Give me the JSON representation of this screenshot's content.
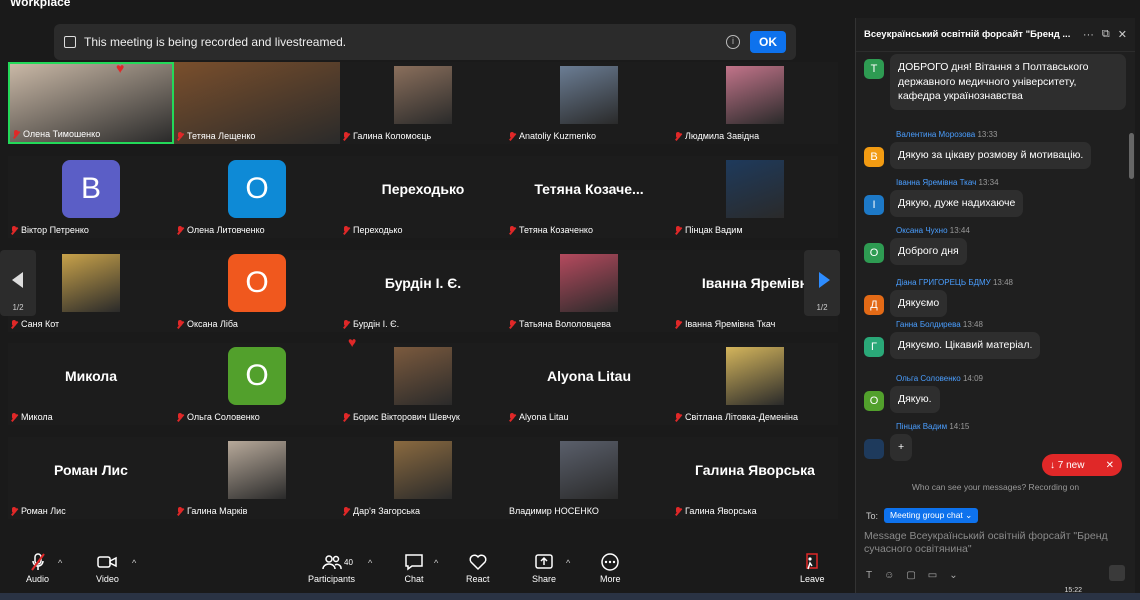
{
  "app": {
    "brand": "Workplace"
  },
  "banner": {
    "text": "This meeting is being recorded and livestreamed.",
    "ok_label": "OK",
    "info_icon": "info-icon"
  },
  "grid": {
    "tiles": [
      {
        "name": "Олена Тимошенко",
        "kind": "photo",
        "active": true,
        "photo_color": "#c9b8a6"
      },
      {
        "name": "Тетяна Лещенко",
        "kind": "photo",
        "photo_color": "#7a4f2c"
      },
      {
        "name": "Галина Коломоєць",
        "kind": "photo",
        "photo_color": "#8a6f5c"
      },
      {
        "name": "Anatoliy Kuzmenko",
        "kind": "photo",
        "photo_color": "#6b7d94"
      },
      {
        "name": "Людмила Завідна",
        "kind": "photo",
        "photo_color": "#c2748a"
      },
      {
        "name": "Віктор Петренко",
        "kind": "letter",
        "letter": "B",
        "color": "#5b5ec6"
      },
      {
        "name": "Олена Литовченко",
        "kind": "letter",
        "letter": "O",
        "color": "#0e8ad6"
      },
      {
        "name": "Переходько",
        "kind": "text",
        "display": "Переходько"
      },
      {
        "name": "Тетяна Козаченко",
        "kind": "text",
        "display": "Тетяна  Козаче..."
      },
      {
        "name": "Пінцак Вадим",
        "kind": "photo",
        "photo_color": "#1e3a5c"
      },
      {
        "name": "Саня Кот",
        "kind": "photo",
        "photo_color": "#c8a24a"
      },
      {
        "name": "Оксана Ліба",
        "kind": "letter",
        "letter": "O",
        "color": "#f0581e"
      },
      {
        "name": "Бурдін І. Є.",
        "kind": "text",
        "display": "Бурдін І. Є."
      },
      {
        "name": "Татьяна Вололовцева",
        "kind": "photo",
        "photo_color": "#b54a5e"
      },
      {
        "name": "Іванна Яремівна Ткач",
        "kind": "text",
        "display": "Іванна  Яремівн"
      },
      {
        "name": "Микола",
        "kind": "text",
        "display": "Микола"
      },
      {
        "name": "Ольга Соловенко",
        "kind": "letter",
        "letter": "O",
        "color": "#52a02c"
      },
      {
        "name": "Борис Вікторович Шевчук",
        "kind": "photo",
        "photo_color": "#7b5a3e"
      },
      {
        "name": "Alyona Litau",
        "kind": "text",
        "display": "Alyona Litau"
      },
      {
        "name": "Світлана Літовка-Деменіна",
        "kind": "photo",
        "photo_color": "#d4b55c"
      },
      {
        "name": "Роман Лис",
        "kind": "text",
        "display": "Роман  Лис"
      },
      {
        "name": "Галина Марків",
        "kind": "photo",
        "photo_color": "#b7a99a"
      },
      {
        "name": "Дар'я Загорська",
        "kind": "photo",
        "photo_color": "#8a6a40"
      },
      {
        "name": "Владимир НОСЕНКО",
        "kind": "photo",
        "photo_color": "#5a5f6b",
        "unmuted": true
      },
      {
        "name": "Галина Яворська",
        "kind": "text",
        "display": "Галина  Яворська"
      }
    ],
    "page_left": "1/2",
    "page_right": "1/2"
  },
  "toolbar": {
    "audio": "Audio",
    "video": "Video",
    "participants": "Participants",
    "participants_count": "40",
    "chat": "Chat",
    "react": "React",
    "share": "Share",
    "more": "More",
    "leave": "Leave"
  },
  "chat": {
    "title": "Всеукраїнський освітній форсайт \"Бренд ...",
    "messages": [
      {
        "author": "",
        "time": "",
        "avatar_letter": "Т",
        "avatar_color": "#2e9b52",
        "text": "ДОБРОГО дня! Вітання з Полтавського державного медичного університету, кафедра українознавства"
      },
      {
        "author": "Валентина Морозова",
        "time": "13:33",
        "avatar_letter": "В",
        "avatar_color": "#f29b12",
        "text": "Дякую за цікаву розмову й мотивацію."
      },
      {
        "author": "Іванна Яремівна Ткач",
        "time": "13:34",
        "avatar_letter": "І",
        "avatar_color": "#1d79c7",
        "text": "Дякую, дуже надихаюче"
      },
      {
        "author": "Оксана Чухно",
        "time": "13:44",
        "avatar_letter": "О",
        "avatar_color": "#2e9b52",
        "text": "Доброго дня"
      },
      {
        "author": "Діана ГРИГОРЕЦЬ БДМУ",
        "time": "13:48",
        "avatar_letter": "Д",
        "avatar_color": "#e36a16",
        "text": "Дякуємо"
      },
      {
        "author": "Ганна Болдирева",
        "time": "13:48",
        "avatar_letter": "Г",
        "avatar_color": "#2aa878",
        "text": "Дякуємо. Цікавий матеріал."
      },
      {
        "author": "Ольга Соловенко",
        "time": "14:09",
        "avatar_letter": "О",
        "avatar_color": "#52a02c",
        "text": "Дякую."
      },
      {
        "author": "Пінцак Вадим",
        "time": "14:15",
        "avatar_letter": "",
        "avatar_color": "#1e3a5c",
        "text": "+"
      }
    ],
    "new_pill": "↓  7 new",
    "hint": "Who can see your messages? Recording on",
    "to_label": "To:",
    "to_value": "Meeting group chat",
    "placeholder": "Message Всеукраїнський освітній форсайт \"Бренд сучасного освітянина\""
  },
  "taskbar": {
    "time": "15:22"
  }
}
